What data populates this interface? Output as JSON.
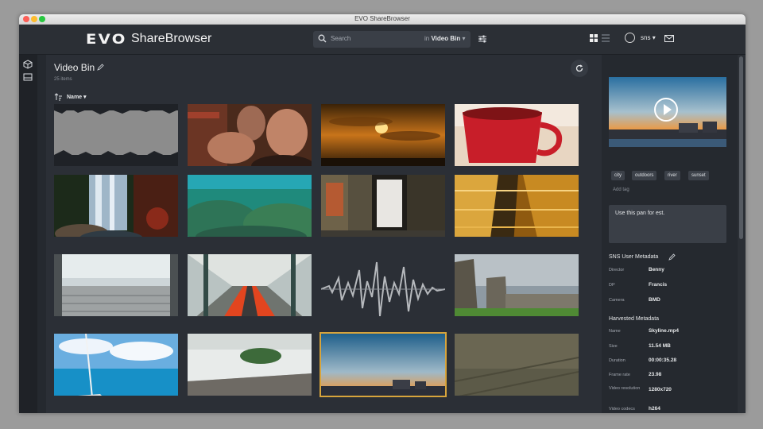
{
  "window": {
    "title": "EVO ShareBrowser"
  },
  "header": {
    "logo_mark": "EVO",
    "logo_text": "ShareBrowser",
    "search_placeholder": "Search",
    "search_in_prefix": "in",
    "search_scope": "Video Bin",
    "user": "sns"
  },
  "bin": {
    "title": "Video Bin",
    "count": "25 items",
    "sort_label": "Name"
  },
  "thumbnails": [
    {
      "name": "waveform-clip-1"
    },
    {
      "name": "man-selfie"
    },
    {
      "name": "sunset-clouds"
    },
    {
      "name": "red-coffee-cup"
    },
    {
      "name": "waterfall"
    },
    {
      "name": "underwater-reef"
    },
    {
      "name": "hallway-door"
    },
    {
      "name": "golden-escalators"
    },
    {
      "name": "moving-walkway"
    },
    {
      "name": "red-walkway-corridor"
    },
    {
      "name": "waveform-clip-2"
    },
    {
      "name": "stone-ruins"
    },
    {
      "name": "sailboat-sea"
    },
    {
      "name": "beach-waves"
    },
    {
      "name": "skyline-dusk"
    },
    {
      "name": "grass-field"
    }
  ],
  "detail": {
    "tags": [
      "city",
      "outdoors",
      "river",
      "sunset"
    ],
    "add_tag": "Add tag",
    "comment": "Use this pan for est.",
    "user_metadata_title": "SNS User Metadata",
    "user_metadata": [
      {
        "key": "Director",
        "value": "Benny"
      },
      {
        "key": "DP",
        "value": "Francis"
      },
      {
        "key": "Camera",
        "value": "BMD"
      }
    ],
    "harvested_title": "Harvested Metadata",
    "harvested": [
      {
        "key": "Name",
        "value": "Skyline.mp4"
      },
      {
        "key": "Size",
        "value": "11.54 MB"
      },
      {
        "key": "Duration",
        "value": "00:00:35.28"
      },
      {
        "key": "Frame rate",
        "value": "23.98"
      },
      {
        "key": "Video resolution",
        "value": "1280x720"
      },
      {
        "key": "Video codecs",
        "value": "h264"
      }
    ]
  },
  "colors": {
    "accent": "#d7a43c",
    "background": "#2b2f36",
    "panel": "#25292f"
  }
}
